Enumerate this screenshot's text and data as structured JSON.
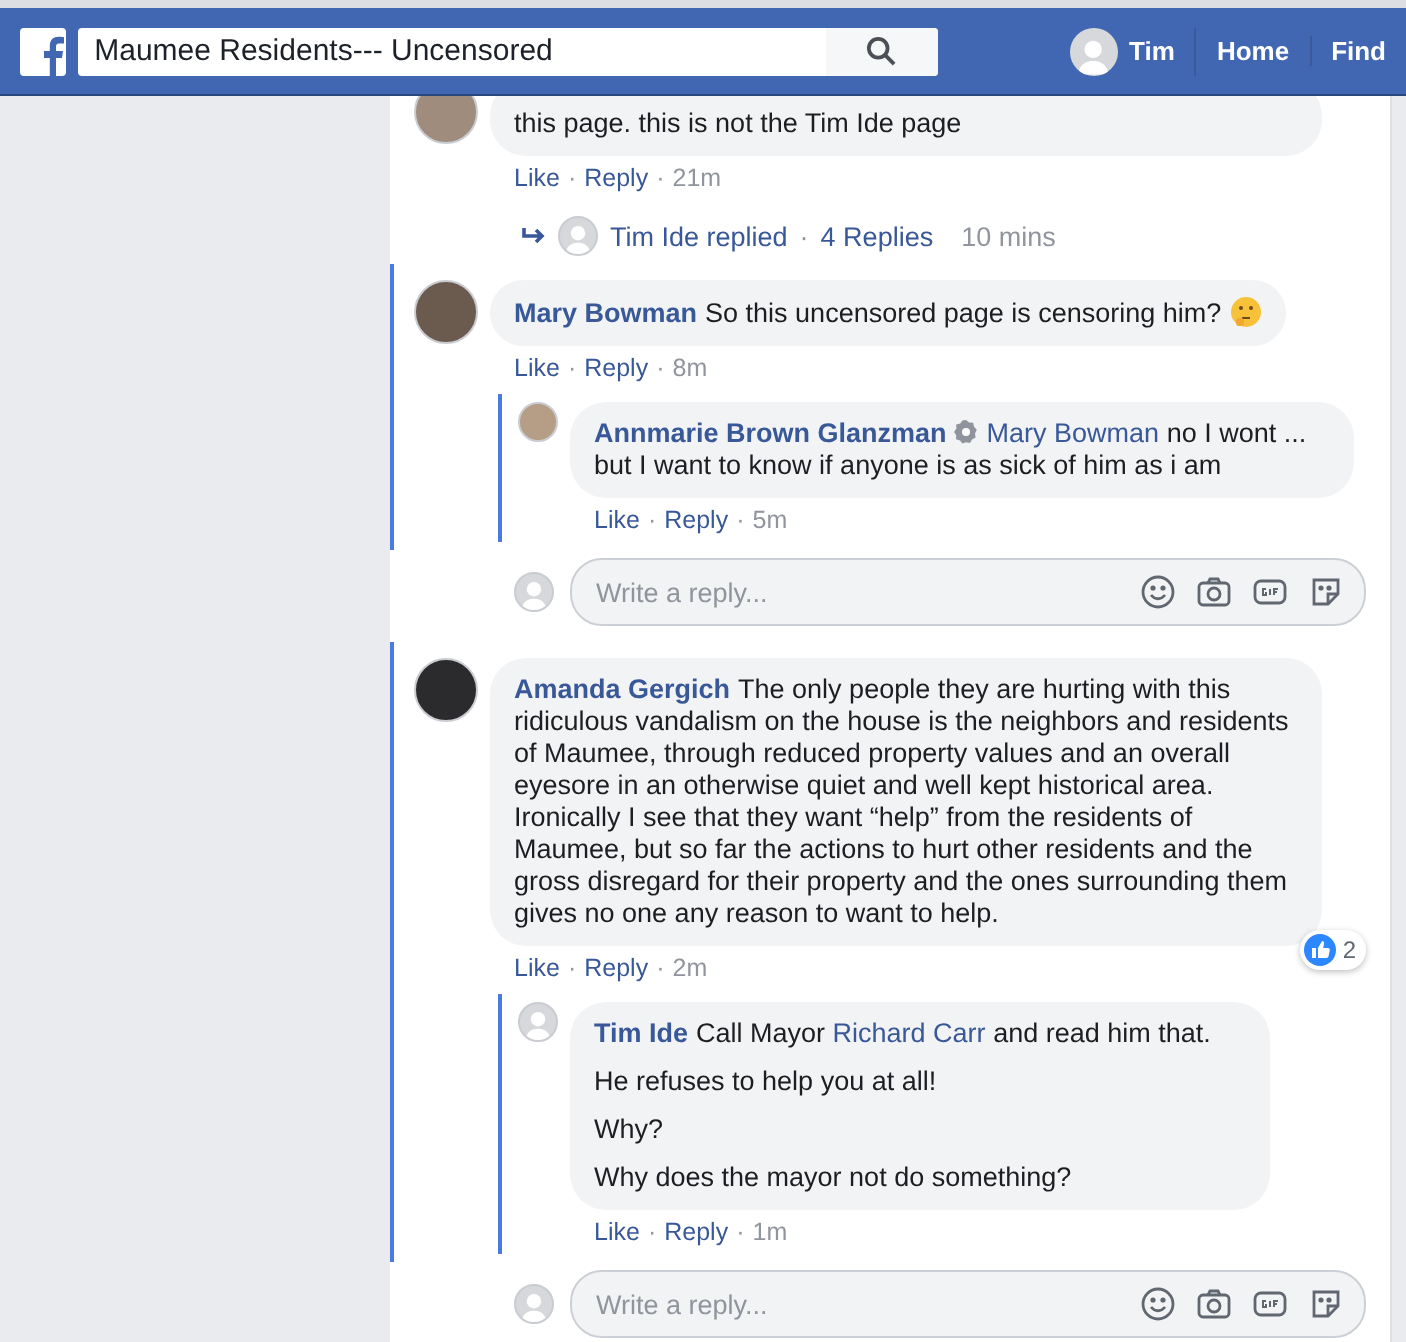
{
  "header": {
    "search_value": "Maumee Residents--- Uncensored",
    "nav": [
      "Tim",
      "Home",
      "Find"
    ]
  },
  "separator": "·",
  "top_comment": {
    "text": "this page. this is not the Tim Ide page",
    "actions": [
      "Like",
      "Reply"
    ],
    "time": "21m",
    "replies_summary": {
      "text": "Tim Ide replied",
      "count": "4 Replies",
      "time": "10 mins"
    }
  },
  "threads": [
    {
      "comment": {
        "author": "Mary Bowman",
        "segments": [
          {
            "kind": "text",
            "text": "So this uncensored page is censoring him?"
          }
        ],
        "emoji": true,
        "actions": [
          "Like",
          "Reply"
        ],
        "time": "8m"
      },
      "replies": [
        {
          "author": "Annmarie Brown Glanzman",
          "badge": true,
          "paragraphs": [
            [
              {
                "kind": "mention",
                "text": "Mary Bowman"
              },
              {
                "kind": "text",
                "text": " no I wont ... but I want to know if anyone is as sick of him as i am"
              }
            ]
          ],
          "actions": [
            "Like",
            "Reply"
          ],
          "time": "5m"
        }
      ],
      "reply_placeholder": "Write a reply..."
    },
    {
      "comment": {
        "author": "Amanda Gergich",
        "segments": [
          {
            "kind": "text",
            "text": "The only people they are hurting with this ridiculous vandalism on the house is the neighbors and residents of Maumee, through reduced property values and an overall eyesore in an otherwise quiet and well kept historical area. Ironically I see that they want “help” from the residents of Maumee, but so far the actions to hurt other residents and the gross disregard for their property and the ones surrounding them gives no one any reason to want to help."
          }
        ],
        "emoji": false,
        "reactions": "2",
        "actions": [
          "Like",
          "Reply"
        ],
        "time": "2m"
      },
      "replies": [
        {
          "author": "Tim Ide",
          "badge": false,
          "paragraphs": [
            [
              {
                "kind": "text",
                "text": "Call Mayor "
              },
              {
                "kind": "mention",
                "text": "Richard Carr"
              },
              {
                "kind": "text",
                "text": " and read him that."
              }
            ],
            [
              {
                "kind": "text",
                "text": "He refuses to help you at all!"
              }
            ],
            [
              {
                "kind": "text",
                "text": "Why?"
              }
            ],
            [
              {
                "kind": "text",
                "text": "Why does the mayor not do something?"
              }
            ]
          ],
          "actions": [
            "Like",
            "Reply"
          ],
          "time": "1m"
        }
      ],
      "reply_placeholder": "Write a reply..."
    }
  ]
}
